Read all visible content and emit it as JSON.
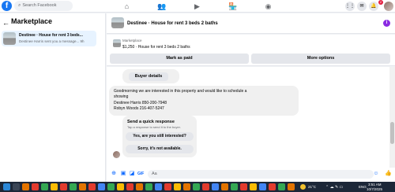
{
  "topbar": {
    "logo": "f",
    "search_placeholder": "Search Facebook",
    "notification_count": "2"
  },
  "sidebar": {
    "title": "Marketplace",
    "conversation": {
      "name": "Destinee · House for rent 3 beds...",
      "preview": "Destinee Harris sent you a message... 9h"
    }
  },
  "chat": {
    "title": "Destinee · House for rent 3 beds 2 baths",
    "listing_label": "Marketplace",
    "listing_text": "$1,250 · House for rent 3 beds 2 baths",
    "mark_paid_label": "Mark as paid",
    "more_options_label": "More options",
    "buyer_details_label": "Buyer details",
    "message_lines": [
      "Goodmorning we are interested in this property and would like to schedule a",
      "showing",
      "Destinee Harris 850-200-7948",
      "Robyn Woods 216-407-5247"
    ],
    "quick_response": {
      "title": "Send a quick response",
      "subtitle": "Tap a response to send it to the buyer.",
      "options": [
        "Yes, are you still interested?",
        "Sorry, it's not available."
      ]
    },
    "composer_placeholder": "Aa"
  },
  "taskbar": {
    "temperature": "21°C",
    "language": "ENG",
    "time": "3:51 AM",
    "date": "10/7/2025"
  },
  "colors": {
    "brand": "#1877f2",
    "accent": "#0866ff",
    "info_icon": "#8a2be2",
    "badge": "#e41e3f"
  }
}
